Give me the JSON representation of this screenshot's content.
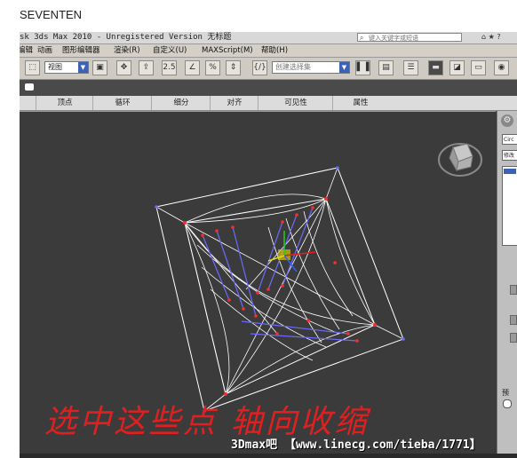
{
  "caption": "SEVENTEN",
  "window": {
    "title": "sk 3ds Max  2010  - Unregistered Version  无标题",
    "search_placeholder": "键入关键字或短语",
    "title_icons": "⌂ ★ ?"
  },
  "menubar": {
    "items": [
      "编辑",
      "动画",
      "图形编辑器",
      "渲染(R)",
      "自定义(U)",
      "MAXScript(M)",
      "帮助(H)"
    ]
  },
  "toolbar": {
    "view_select": "视图",
    "selection_set_placeholder": "创建选择集"
  },
  "ribbon": {
    "tabs": [
      "顶点",
      "循环",
      "细分",
      "对齐",
      "可见性",
      "属性"
    ]
  },
  "command_panel": {
    "name_field": "Circ",
    "modifier_field": "修改",
    "preset_label": "预"
  },
  "overlay": {
    "handwritten_note": "选中这些点  轴向收缩",
    "watermark": "3Dmax吧 【www.linecg.com/tieba/1771】"
  },
  "colors": {
    "viewport_bg": "#3b3b3b",
    "wire": "#ffffff",
    "vertex": "#ff2a2a",
    "selected_edge": "#6a6aff",
    "handwriting": "#e02020"
  }
}
